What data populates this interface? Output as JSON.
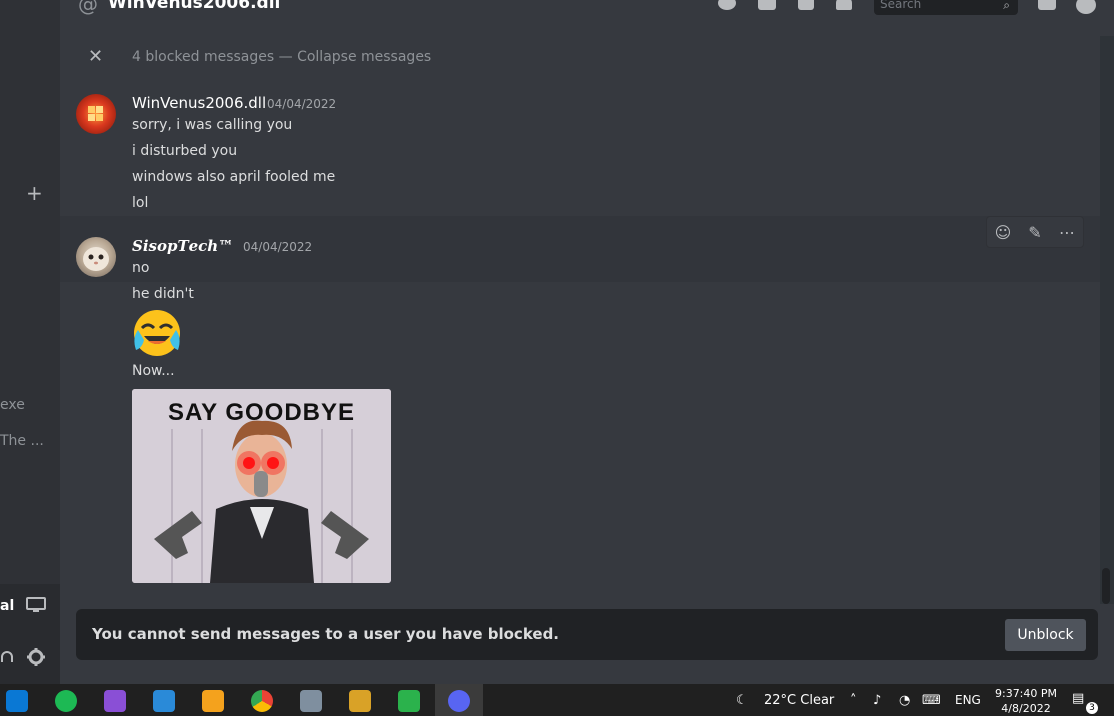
{
  "header": {
    "title": "WinVenus2006.dll",
    "search_placeholder": "Search"
  },
  "sidebar": {
    "partial_items": [
      "exe",
      "The ...",
      "al"
    ]
  },
  "blocked_bar": {
    "text": "4 blocked messages — Collapse messages"
  },
  "messages": [
    {
      "author": "WinVenus2006.dll",
      "timestamp": "04/04/2022",
      "lines": [
        "sorry, i was calling you",
        "i disturbed you",
        "windows also april fooled me",
        "lol"
      ]
    },
    {
      "author": "𝑺𝒊𝒔𝒐𝒑𝑻𝒆𝒄𝒉™",
      "timestamp": "04/04/2022",
      "lines": [
        "no",
        "he didn't"
      ],
      "emoji": "😂",
      "after_emoji": "Now...",
      "image_caption": "SAY GOODBYE"
    }
  ],
  "composer": {
    "blocked_text": "You cannot send messages to a user you have blocked.",
    "unblock_label": "Unblock"
  },
  "taskbar": {
    "weather": "22°C  Clear",
    "language": "ENG",
    "time": "9:37:40 PM",
    "date": "4/8/2022",
    "notif_count": "3"
  },
  "colors": {
    "background": "#36393f",
    "sidebar": "#2f3136",
    "composer": "#202225",
    "unblock_button": "#4f545c",
    "taskbar": "#202020",
    "discord_blurple": "#5865f2"
  }
}
